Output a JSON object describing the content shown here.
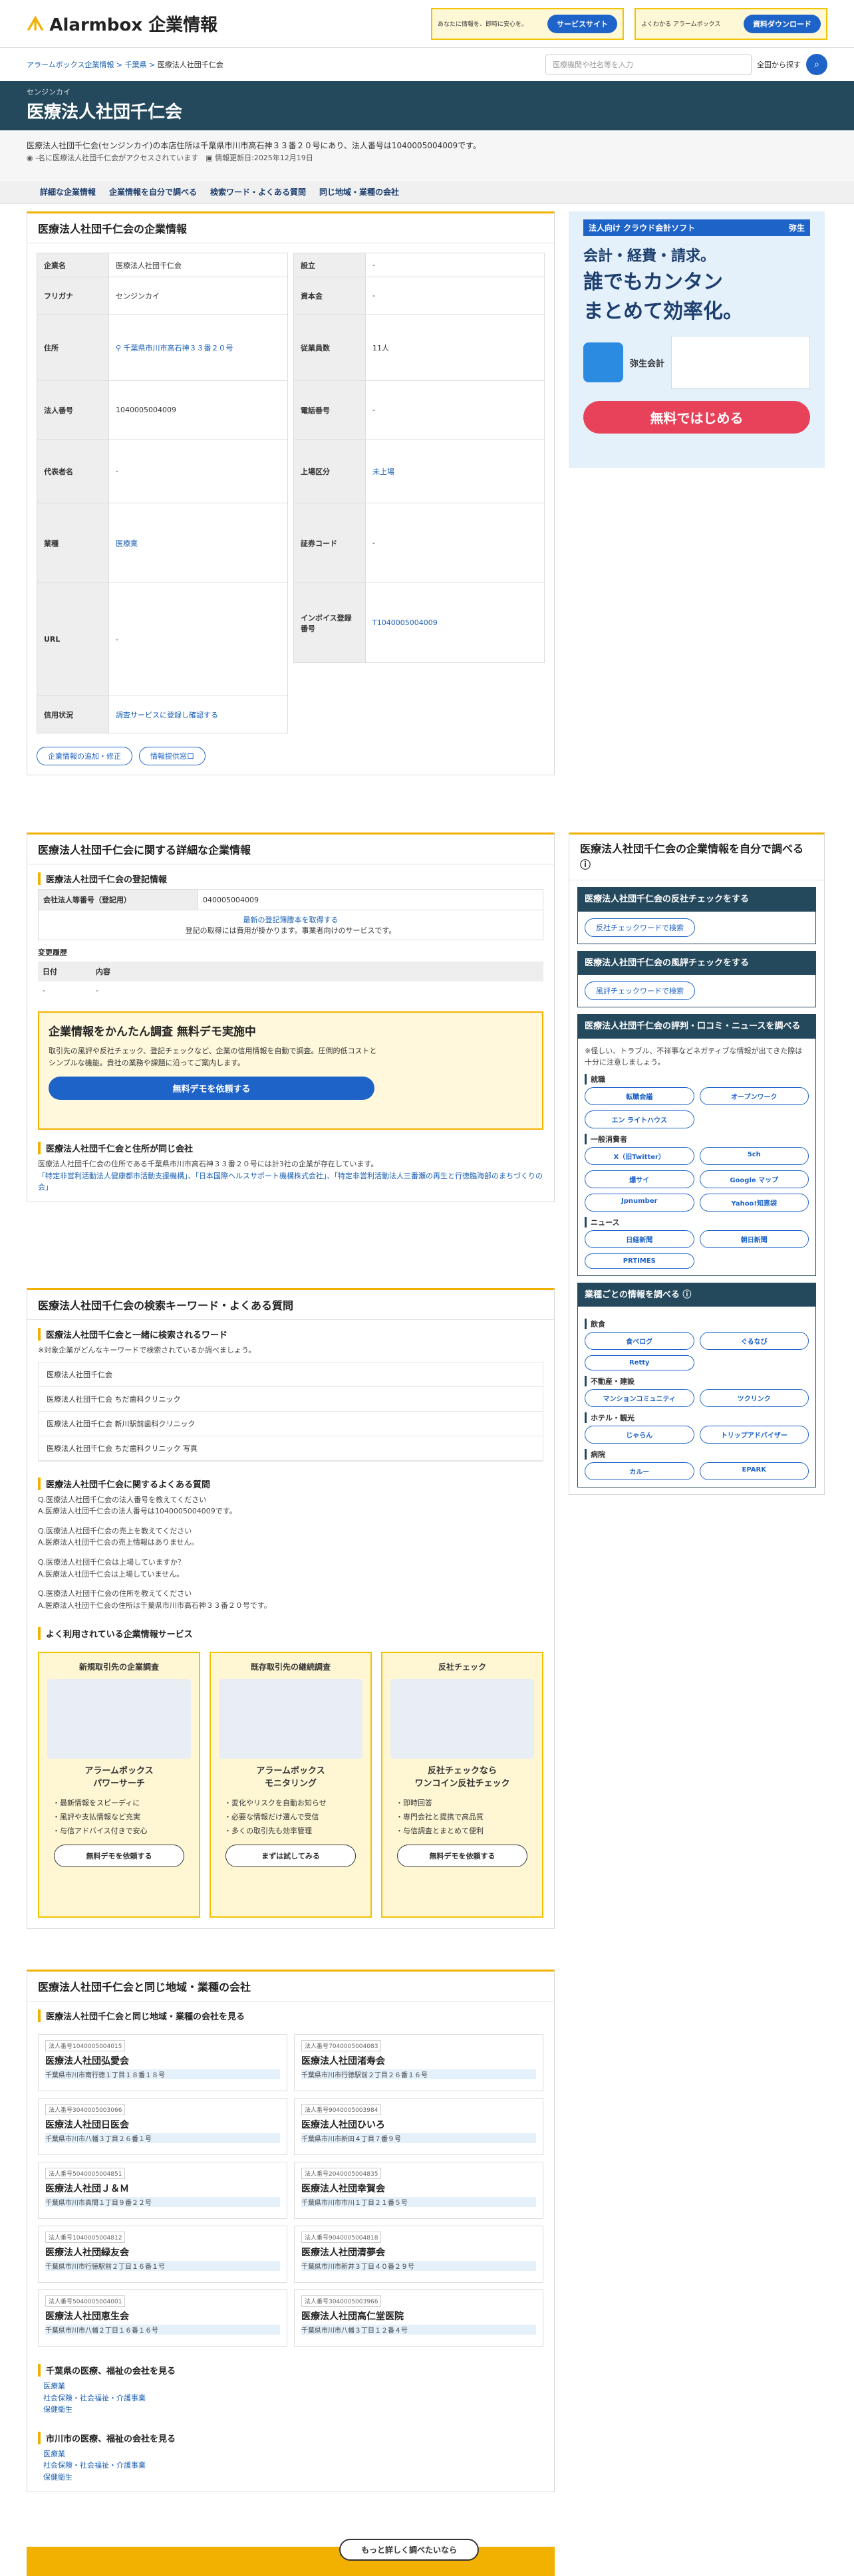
{
  "header": {
    "logo": "Alarmbox 企業情報",
    "banner1_text": "あなたに情報を、即時に安心を。",
    "banner1_btn": "サービスサイト",
    "banner2_text": "よくわかる アラームボックス",
    "banner2_btn": "資料ダウンロード"
  },
  "breadcrumb": [
    "アラームボックス企業情報",
    "千葉県",
    "医療法人社団千仁会"
  ],
  "search": {
    "placeholder": "医療機関や社名等を入力",
    "scope": "全国から探す"
  },
  "title": {
    "kana": "センジンカイ",
    "name": "医療法人社団千仁会"
  },
  "intro": {
    "text": "医療法人社団千仁会(センジンカイ)の本店住所は千葉県市川市高石神３３番２０号にあり、法人番号は1040005004009です。",
    "views": "-名に医療法人社団千仁会がアクセスされています",
    "updated": "情報更新日:2025年12月19日"
  },
  "tabs": [
    "詳細な企業情報",
    "企業情報を自分で調べる",
    "検索ワード・よくある質問",
    "同じ地域・業種の会社"
  ],
  "company": {
    "heading": "医療法人社団千仁会の企業情報",
    "left": [
      [
        "企業名",
        "医療法人社団千仁会"
      ],
      [
        "フリガナ",
        "センジンカイ"
      ],
      [
        "住所",
        "千葉県市川市高石神３３番２０号"
      ],
      [
        "法人番号",
        "1040005004009"
      ],
      [
        "代表者名",
        "-"
      ],
      [
        "業種",
        "医療業"
      ],
      [
        "URL",
        "-"
      ],
      [
        "信用状況",
        "調査サービスに登録し確認する"
      ]
    ],
    "right": [
      [
        "設立",
        "-"
      ],
      [
        "資本金",
        "-"
      ],
      [
        "従業員数",
        "11人"
      ],
      [
        "電話番号",
        "-"
      ],
      [
        "上場区分",
        "未上場"
      ],
      [
        "証券コード",
        "-"
      ],
      [
        "インボイス登録番号",
        "T1040005004009"
      ]
    ],
    "btn_edit": "企業情報の追加・修正",
    "btn_provide": "情報提供窓口"
  },
  "ad": {
    "tag": "法人向け クラウド会計ソフト",
    "brand": "弥生",
    "l1": "会計・経費・請求。",
    "l2": "誰でもカンタン",
    "l3": "まとめて効率化。",
    "product": "弥生会計",
    "cta": "無料ではじめる"
  },
  "detail": {
    "heading": "医療法人社団千仁会に関する詳細な企業情報",
    "reg_title": "医療法人社団千仁会の登記情報",
    "reg_label": "会社法人等番号（登記用）",
    "reg_value": "040005004009",
    "reg_link": "最新の登記簿謄本を取得する",
    "reg_note": "登記の取得には費用が掛かります。事業者向けのサービスです。",
    "change_title": "変更履歴",
    "change_cols": [
      "日付",
      "内容"
    ],
    "demo_title": "企業情報をかんたん調査 無料デモ実施中",
    "demo_text": "取引先の風評や反社チェック、登記チェックなど、企業の信用情報を自動で調査。圧倒的低コストとシンプルな機能。貴社の業務や課題に沿ってご案内します。",
    "demo_btn": "無料デモを依頼する",
    "same_addr_title": "医療法人社団千仁会と住所が同じ会社",
    "same_addr_text": "医療法人社団千仁会の住所である千葉県市川市高石神３３番２０号には計3社の企業が存在しています。",
    "same_addr_links": "「特定非営利活動法人健康都市活動支援機構」、「日本国際ヘルスサポート機構株式会社」、「特定非営利活動法人三番瀬の再生と行徳臨海部のまちづくりの会」"
  },
  "keywords": {
    "heading": "医療法人社団千仁会の検索キーワード・よくある質問",
    "kw_title": "医療法人社団千仁会と一緒に検索されるワード",
    "kw_note": "※対象企業がどんなキーワードで検索されているか調べましょう。",
    "items": [
      "医療法人社団千仁会",
      "医療法人社団千仁会 ちだ歯科クリニック",
      "医療法人社団千仁会 新川駅前歯科クリニック",
      "医療法人社団千仁会 ちだ歯科クリニック 写真"
    ],
    "faq_title": "医療法人社団千仁会に関するよくある質問",
    "faq": [
      "Q.医療法人社団千仁会の法人番号を教えてください",
      "A.医療法人社団千仁会の法人番号は1040005004009です。",
      "Q.医療法人社団千仁会の売上を教えてください",
      "A.医療法人社団千仁会の売上情報はありません。",
      "Q.医療法人社団千仁会は上場していますか？",
      "A.医療法人社団千仁会は上場していません。",
      "Q.医療法人社団千仁会の住所を教えてください",
      "A.医療法人社団千仁会の住所は千葉県市川市高石神３３番２０号です。"
    ]
  },
  "services": {
    "title": "よく利用されている企業情報サービス",
    "items": [
      {
        "t": "新規取引先の企業調査",
        "n": "アラームボックス\nパワーサーチ",
        "f": [
          "・最新情報をスピーディに",
          "・風評や支払情報など充実",
          "・与信アドバイス付きで安心"
        ],
        "b": "無料デモを依頼する"
      },
      {
        "t": "既存取引先の継続調査",
        "n": "アラームボックス\nモニタリング",
        "f": [
          "・変化やリスクを自動お知らせ",
          "・必要な情報だけ選んで受信",
          "・多くの取引先も効率管理"
        ],
        "b": "まずは試してみる"
      },
      {
        "t": "反社チェック",
        "n": "反社チェックなら\nワンコイン反社チェック",
        "f": [
          "・即時回答",
          "・専門会社と提携で高品質",
          "・与信調査とまとめて便利"
        ],
        "b": "無料デモを依頼する"
      }
    ]
  },
  "same": {
    "heading": "医療法人社団千仁会と同じ地域・業種の会社",
    "sub": "医療法人社団千仁会と同じ地域・業種の会社を見る",
    "items": [
      [
        "法人番号1040005004015",
        "医療法人社団弘愛会",
        "千葉県市川市南行徳１丁目１８番１８号"
      ],
      [
        "法人番号7040005004083",
        "医療法人社団渚寿会",
        "千葉県市川市行徳駅前２丁目２６番１６号"
      ],
      [
        "法人番号3040005003066",
        "医療法人社団日医会",
        "千葉県市川市八幡３丁目２６番１号"
      ],
      [
        "法人番号9040005003984",
        "医療法人社団ひいろ",
        "千葉県市川市新田４丁目７番９号"
      ],
      [
        "法人番号5040005004851",
        "医療法人社団Ｊ＆Ｍ",
        "千葉県市川市真間１丁目９番２２号"
      ],
      [
        "法人番号2040005004835",
        "医療法人社団幸賀会",
        "千葉県市川市市川１丁目２１番５号"
      ],
      [
        "法人番号1040005004812",
        "医療法人社団緑友会",
        "千葉県市川市行徳駅前２丁目１６番１号"
      ],
      [
        "法人番号9040005004818",
        "医療法人社団清夢会",
        "千葉県市川市新井３丁目４０番２９号"
      ],
      [
        "法人番号5040005004001",
        "医療法人社団恵生会",
        "千葉県市川市八幡２丁目１６番１６号"
      ],
      [
        "法人番号3040005003966",
        "医療法人社団高仁堂医院",
        "千葉県市川市八幡３丁目１２番４号"
      ]
    ],
    "pref_title": "千葉県の医療、福祉の会社を見る",
    "pref_links": [
      "医療業",
      "社会保険・社会福祉・介護事業",
      "保健衛生"
    ],
    "city_title": "市川市の医療、福祉の会社を見る",
    "city_links": [
      "医療業",
      "社会保険・社会福祉・介護事業",
      "保健衛生"
    ]
  },
  "side": {
    "heading": "医療法人社団千仁会の企業情報を自分で調べる",
    "box1_title": "医療法人社団千仁会の反社チェックをする",
    "box1_btn": "反社チェックワードで検索",
    "box2_title": "医療法人社団千仁会の風評チェックをする",
    "box2_btn": "風評チェックワードで検索",
    "box3_title": "医療法人社団千仁会の評判・口コミ・ニュースを調べる",
    "box3_note": "※怪しい、トラブル、不祥事などネガティブな情報が出てきた際は十分に注意しましょう。",
    "grp1": "就職",
    "grp1_items": [
      "転職会議",
      "オープンワーク",
      "エン ライトハウス"
    ],
    "grp2": "一般消費者",
    "grp2_items": [
      "X（旧Twitter）",
      "5ch",
      "爆サイ",
      "Google マップ",
      "Jpnumber",
      "Yahoo!知恵袋"
    ],
    "grp3": "ニュース",
    "grp3_items": [
      "日経新聞",
      "朝日新聞",
      "PRTIMES"
    ],
    "box4_title": "業種ごとの情報を調べる",
    "g4a": "飲食",
    "g4a_items": [
      "食べログ",
      "ぐるなび",
      "Retty"
    ],
    "g4b": "不動産・建設",
    "g4b_items": [
      "マンションコミュニティ",
      "ツクリンク"
    ],
    "g4c": "ホテル・観光",
    "g4c_items": [
      "じゃらん",
      "トリップアドバイザー"
    ],
    "g4d": "病院",
    "g4d_items": [
      "カルー",
      "EPARK"
    ]
  },
  "footer_cta": "もっと詳しく調べたいなら"
}
